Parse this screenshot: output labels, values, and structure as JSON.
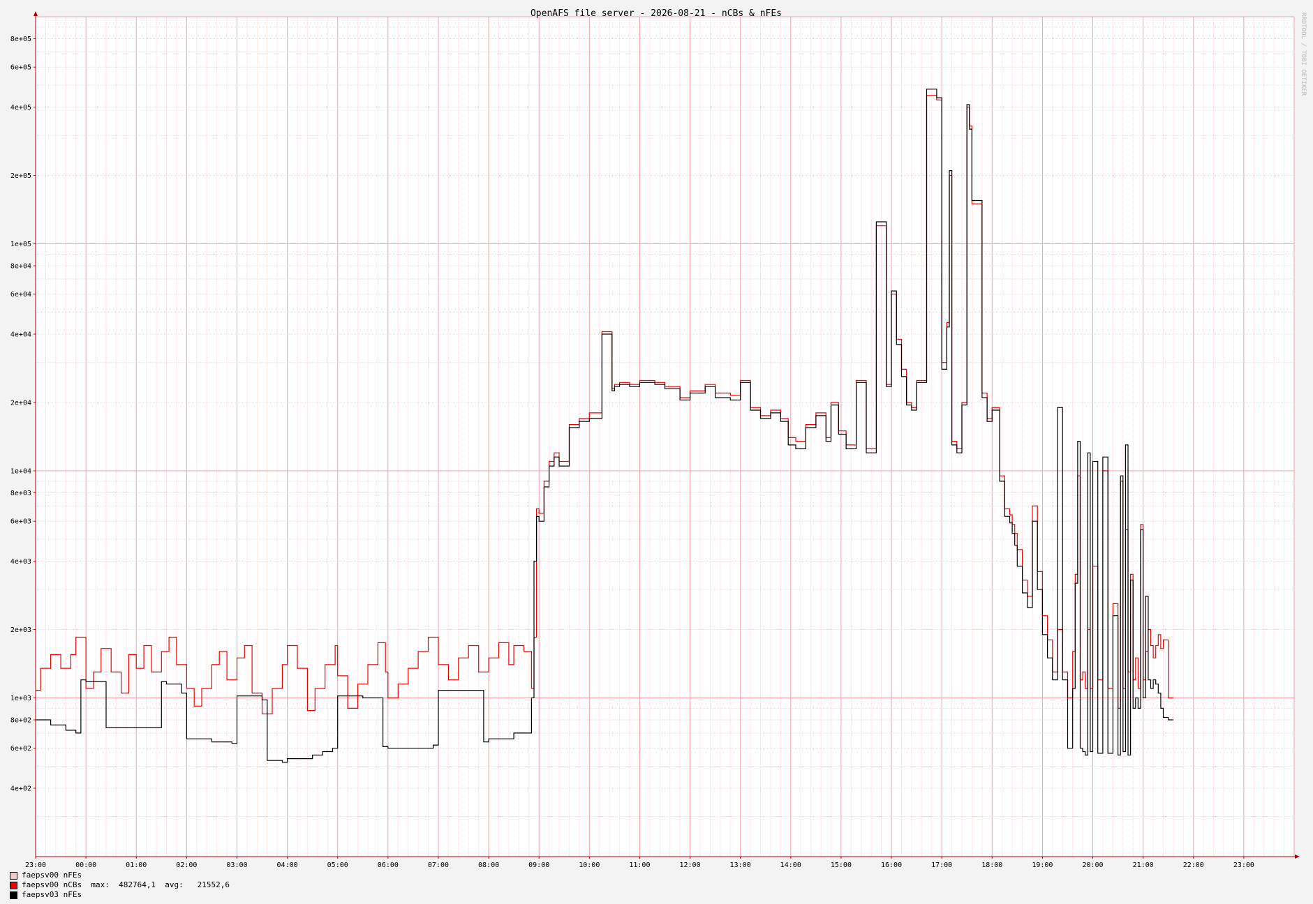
{
  "watermark": "RRDTOOL / TOBI OETIKER",
  "chart_data": {
    "type": "line",
    "title": "OpenAFS file server - 2026-08-21 - nCBs & nFEs",
    "yscale": "log",
    "ylim": [
      200,
      1000000
    ],
    "xlim": [
      23.0,
      24.0
    ],
    "grid": true,
    "legend_position": "bottom-left",
    "y_ticks": [
      "4e+02",
      "6e+02",
      "8e+02",
      "1e+03",
      "2e+03",
      "4e+03",
      "6e+03",
      "8e+03",
      "1e+04",
      "2e+04",
      "4e+04",
      "6e+04",
      "8e+04",
      "1e+05",
      "2e+05",
      "4e+05",
      "6e+05",
      "8e+05"
    ],
    "x_ticks": [
      "23:00",
      "00:00",
      "01:00",
      "02:00",
      "03:00",
      "04:00",
      "05:00",
      "06:00",
      "07:00",
      "08:00",
      "09:00",
      "10:00",
      "11:00",
      "12:00",
      "13:00",
      "14:00",
      "15:00",
      "16:00",
      "17:00",
      "18:00",
      "19:00",
      "20:00",
      "21:00",
      "22:00",
      "23:00"
    ],
    "series": [
      {
        "name": "faepsv00 nFEs",
        "color": "#f4c8cc",
        "hours": [],
        "values": []
      },
      {
        "name": "faepsv00 nCBs",
        "color": "#ee0000",
        "stats": "max:  482764,1  avg:   21552,6",
        "hours": [
          23.0,
          23.1,
          23.3,
          23.5,
          23.7,
          23.8,
          24.0,
          24.15,
          24.3,
          24.5,
          24.7,
          24.85,
          25.0,
          25.15,
          25.3,
          25.5,
          25.65,
          25.8,
          26.0,
          26.15,
          26.3,
          26.5,
          26.65,
          26.8,
          27.0,
          27.15,
          27.3,
          27.5,
          27.7,
          27.9,
          28.0,
          28.2,
          28.4,
          28.55,
          28.75,
          28.95,
          29.0,
          29.2,
          29.4,
          29.6,
          29.8,
          29.95,
          30.0,
          30.2,
          30.4,
          30.6,
          30.8,
          31.0,
          31.2,
          31.4,
          31.6,
          31.8,
          32.0,
          32.2,
          32.4,
          32.5,
          32.7,
          32.85,
          32.9,
          32.95,
          33.0,
          33.1,
          33.2,
          33.3,
          33.4,
          33.6,
          33.8,
          34.0,
          34.25,
          34.45,
          34.5,
          34.6,
          34.8,
          35.0,
          35.3,
          35.5,
          35.8,
          36.0,
          36.3,
          36.5,
          36.8,
          37.0,
          37.2,
          37.4,
          37.6,
          37.8,
          37.95,
          38.1,
          38.3,
          38.5,
          38.7,
          38.8,
          38.95,
          39.1,
          39.3,
          39.5,
          39.7,
          39.9,
          40.0,
          40.1,
          40.2,
          40.3,
          40.4,
          40.5,
          40.7,
          40.9,
          41.0,
          41.1,
          41.15,
          41.2,
          41.3,
          41.4,
          41.5,
          41.55,
          41.6,
          41.8,
          41.9,
          42.0,
          42.15,
          42.25,
          42.35,
          42.4,
          42.45,
          42.5,
          42.6,
          42.7,
          42.8,
          42.9,
          43.0,
          43.1,
          43.2,
          43.3,
          43.4,
          43.5,
          43.6,
          43.65,
          43.7,
          43.75,
          43.8,
          43.85,
          43.9,
          43.95,
          44.0,
          44.1,
          44.2,
          44.3,
          44.4,
          44.5,
          44.55,
          44.6,
          44.65,
          44.7,
          44.75,
          44.8,
          44.85,
          44.9,
          44.95,
          45.0,
          45.05,
          45.1,
          45.15,
          45.2,
          45.25,
          45.3,
          45.35,
          45.4,
          45.5,
          45.6,
          45.7,
          45.8,
          45.95
        ],
        "values": [
          1080,
          1350,
          1550,
          1350,
          1550,
          1850,
          1100,
          1300,
          1650,
          1300,
          1050,
          1550,
          1350,
          1700,
          1300,
          1600,
          1850,
          1400,
          1100,
          920,
          1100,
          1400,
          1600,
          1200,
          1500,
          1700,
          1050,
          850,
          1100,
          1400,
          1700,
          1350,
          880,
          1100,
          1400,
          1700,
          1250,
          900,
          1150,
          1400,
          1750,
          1300,
          1000,
          1150,
          1350,
          1600,
          1850,
          1400,
          1200,
          1500,
          1700,
          1300,
          1500,
          1750,
          1400,
          1700,
          1600,
          1100,
          1850,
          6800,
          6500,
          9000,
          11000,
          12000,
          11000,
          16000,
          17000,
          18000,
          41000,
          23000,
          24000,
          24500,
          24000,
          25000,
          24500,
          23500,
          21000,
          22500,
          24000,
          22000,
          21500,
          25000,
          19000,
          17500,
          18500,
          17000,
          14000,
          13500,
          16000,
          18000,
          14000,
          20000,
          15000,
          13000,
          25000,
          12500,
          120000,
          24000,
          60000,
          38000,
          28000,
          20000,
          19000,
          25000,
          450000,
          430000,
          30000,
          45000,
          200000,
          13500,
          12500,
          20000,
          400000,
          330000,
          150000,
          22000,
          17000,
          19000,
          9500,
          6800,
          6400,
          5800,
          5300,
          4500,
          3300,
          2800,
          7000,
          3600,
          2300,
          1800,
          1300,
          2000,
          1300,
          1000,
          1600,
          3500,
          9500,
          1200,
          1300,
          1100,
          2000,
          1100,
          3800,
          1200,
          10000,
          1100,
          2600,
          900,
          9000,
          1100,
          5500,
          1300,
          3500,
          1200,
          1500,
          1100,
          5800,
          1200,
          1600,
          2000,
          1700,
          1500,
          1700,
          1900,
          1650,
          1800,
          1000
        ]
      },
      {
        "name": "faepsv03 nFEs",
        "color": "#000000",
        "hours": [
          23.0,
          23.3,
          23.6,
          23.8,
          23.9,
          24.0,
          24.4,
          24.5,
          24.6,
          25.0,
          25.3,
          25.5,
          25.6,
          25.9,
          26.0,
          26.5,
          26.9,
          27.0,
          27.5,
          27.6,
          27.9,
          28.0,
          28.5,
          28.7,
          28.9,
          29.0,
          29.5,
          29.9,
          30.0,
          30.5,
          30.9,
          31.0,
          31.5,
          31.9,
          32.0,
          32.5,
          32.75,
          32.85,
          32.9,
          32.95,
          33.0,
          33.1,
          33.2,
          33.3,
          33.4,
          33.6,
          33.8,
          34.0,
          34.25,
          34.45,
          34.5,
          34.6,
          34.8,
          35.0,
          35.3,
          35.5,
          35.8,
          36.0,
          36.3,
          36.5,
          36.8,
          37.0,
          37.2,
          37.4,
          37.6,
          37.8,
          37.95,
          38.1,
          38.3,
          38.5,
          38.7,
          38.8,
          38.95,
          39.1,
          39.3,
          39.5,
          39.7,
          39.9,
          40.0,
          40.1,
          40.2,
          40.3,
          40.4,
          40.5,
          40.7,
          40.9,
          41.0,
          41.1,
          41.15,
          41.2,
          41.3,
          41.4,
          41.5,
          41.55,
          41.6,
          41.8,
          41.9,
          42.0,
          42.15,
          42.25,
          42.35,
          42.4,
          42.45,
          42.5,
          42.6,
          42.7,
          42.8,
          42.9,
          43.0,
          43.1,
          43.2,
          43.3,
          43.4,
          43.5,
          43.6,
          43.65,
          43.7,
          43.75,
          43.8,
          43.85,
          43.9,
          43.95,
          44.0,
          44.1,
          44.2,
          44.3,
          44.4,
          44.5,
          44.55,
          44.6,
          44.65,
          44.7,
          44.75,
          44.8,
          44.85,
          44.9,
          44.95,
          45.0,
          45.05,
          45.1,
          45.15,
          45.2,
          45.25,
          45.3,
          45.35,
          45.4,
          45.5,
          45.6,
          45.7,
          45.8,
          45.95
        ],
        "values": [
          800,
          760,
          720,
          700,
          1200,
          1180,
          740,
          740,
          740,
          740,
          740,
          1180,
          1150,
          1050,
          660,
          640,
          630,
          1020,
          980,
          530,
          520,
          540,
          560,
          580,
          600,
          1020,
          1000,
          610,
          600,
          600,
          620,
          1080,
          1080,
          640,
          660,
          700,
          700,
          1000,
          4000,
          6300,
          6000,
          8500,
          10500,
          11500,
          10500,
          15500,
          16500,
          17000,
          40000,
          22500,
          23500,
          24000,
          23500,
          24500,
          24000,
          23000,
          20500,
          22000,
          23500,
          21000,
          20500,
          24500,
          18500,
          17000,
          18000,
          16500,
          13000,
          12500,
          15500,
          17500,
          13500,
          19500,
          14500,
          12500,
          24500,
          12000,
          125000,
          23500,
          62000,
          36000,
          26000,
          19500,
          18500,
          24500,
          480000,
          440000,
          28000,
          43000,
          210000,
          13000,
          12000,
          19500,
          410000,
          320000,
          155000,
          21000,
          16500,
          18500,
          9000,
          6300,
          5900,
          5300,
          4700,
          3800,
          2900,
          2500,
          6000,
          3000,
          1900,
          1500,
          1200,
          19000,
          1200,
          600,
          1100,
          3200,
          13500,
          600,
          580,
          560,
          12000,
          580,
          11000,
          570,
          11500,
          570,
          2300,
          560,
          9500,
          580,
          13000,
          560,
          3300,
          900,
          1000,
          900,
          5500,
          1000,
          2800,
          1200,
          1100,
          1200,
          1150,
          1050,
          900,
          820,
          800
        ]
      }
    ]
  }
}
